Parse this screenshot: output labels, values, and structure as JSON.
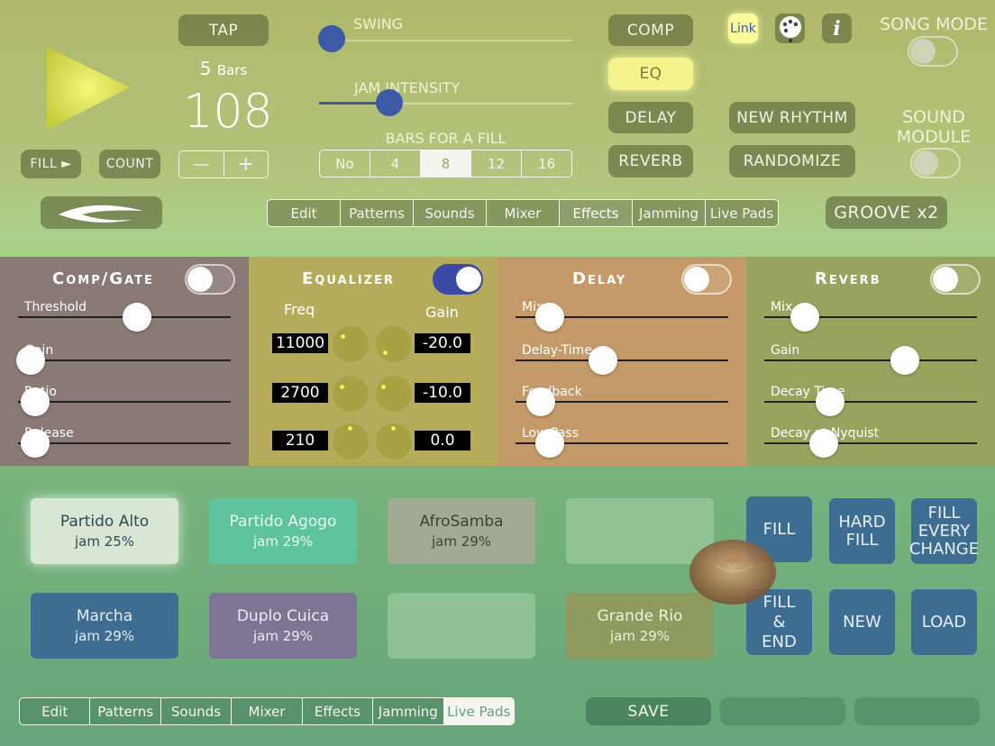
{
  "transport": {
    "play_icon": "play-triangle-icon",
    "tap_label": "TAP",
    "bars_number": "5",
    "bars_unit": "Bars",
    "tempo": "108",
    "minus": "—",
    "plus": "+",
    "fill_label": "FILL ►",
    "count_label": "COUNT",
    "back_icon": "swoosh-arrow-icon"
  },
  "swing": {
    "label": "SWING",
    "value": 0.03
  },
  "jam_intensity": {
    "label": "JAM INTENSITY",
    "value": 0.28
  },
  "bars_for_fill": {
    "label": "BARS FOR A FILL",
    "options": [
      "No",
      "4",
      "8",
      "12",
      "16"
    ],
    "selected": "8"
  },
  "effects_buttons": {
    "comp": "COMP",
    "eq": "EQ",
    "delay": "DELAY",
    "reverb": "REVERB",
    "active": "EQ"
  },
  "rhythm_buttons": {
    "new_rhythm": "NEW RHYTHM",
    "randomize": "RANDOMIZE"
  },
  "top_icons": {
    "link": "Link",
    "palette_icon": "palette-icon",
    "info_icon": "info-icon"
  },
  "song_mode": {
    "label": "SONG MODE",
    "on": false
  },
  "sound_module": {
    "line1": "SOUND",
    "line2": "MODULE",
    "on": false
  },
  "groove": {
    "label": "GROOVE x2"
  },
  "top_tabs": {
    "items": [
      "Edit",
      "Patterns",
      "Sounds",
      "Mixer",
      "Effects",
      "Jamming",
      "Live Pads"
    ],
    "selected": "Effects"
  },
  "panels": {
    "comp": {
      "title": "Comp/Gate",
      "on": false,
      "sliders": [
        {
          "label": "Threshold",
          "value": 0.5
        },
        {
          "label": "Gain",
          "value": 0.0
        },
        {
          "label": "Ratio",
          "value": 0.02
        },
        {
          "label": "Release",
          "value": 0.02
        }
      ]
    },
    "eq": {
      "title": "Equalizer",
      "on": true,
      "freq_label": "Freq",
      "gain_label": "Gain",
      "bands": [
        {
          "freq": "11000",
          "gain": "-20.0"
        },
        {
          "freq": "2700",
          "gain": "-10.0"
        },
        {
          "freq": "210",
          "gain": "0.0"
        }
      ]
    },
    "delay": {
      "title": "Delay",
      "on": false,
      "sliders": [
        {
          "label": "Mix",
          "value": 0.1
        },
        {
          "label": "Delay-Time",
          "value": 0.35
        },
        {
          "label": "Feedback",
          "value": 0.06
        },
        {
          "label": "Low Pass",
          "value": 0.1
        }
      ]
    },
    "reverb": {
      "title": "Reverb",
      "on": false,
      "sliders": [
        {
          "label": "Mix",
          "value": 0.13
        },
        {
          "label": "Gain",
          "value": 0.6
        },
        {
          "label": "Decay Time",
          "value": 0.25
        },
        {
          "label": "Decay at Nyquist",
          "value": 0.22
        }
      ]
    }
  },
  "pads": [
    {
      "name": "Partido Alto",
      "jam": "jam 25%"
    },
    {
      "name": "Partido Agogo",
      "jam": "jam 29%"
    },
    {
      "name": "AfroSamba",
      "jam": "jam 29%"
    },
    {
      "name": "",
      "jam": ""
    },
    {
      "name": "Marcha",
      "jam": "jam 29%"
    },
    {
      "name": "Duplo Cuica",
      "jam": "jam 29%"
    },
    {
      "name": "",
      "jam": ""
    },
    {
      "name": "Grande Rio",
      "jam": "jam 29%"
    }
  ],
  "pad_actions": {
    "fill": "FILL",
    "hard_fill_1": "HARD",
    "hard_fill_2": "FILL",
    "fill_every_1": "FILL",
    "fill_every_2": "EVERY",
    "fill_every_3": "CHANGE",
    "fill_end_1": "FILL",
    "fill_end_2": "&",
    "fill_end_3": "END",
    "new": "NEW",
    "load": "LOAD",
    "cymbal_icon": "cymbal-icon"
  },
  "bottom_tabs": {
    "items": [
      "Edit",
      "Patterns",
      "Sounds",
      "Mixer",
      "Effects",
      "Jamming",
      "Live Pads"
    ],
    "selected": "Live Pads"
  },
  "bottom_buttons": {
    "save": "SAVE"
  }
}
